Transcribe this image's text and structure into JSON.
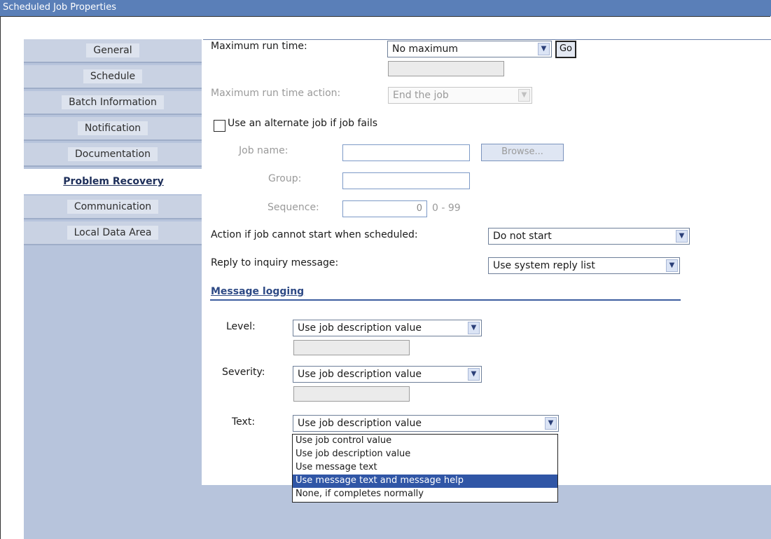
{
  "window": {
    "title": "Scheduled Job Properties"
  },
  "tabs": [
    {
      "label": "General"
    },
    {
      "label": "Schedule"
    },
    {
      "label": "Batch Information"
    },
    {
      "label": "Notification"
    },
    {
      "label": "Documentation"
    },
    {
      "label": "Problem Recovery",
      "active": true
    },
    {
      "label": "Communication"
    },
    {
      "label": "Local Data Area"
    }
  ],
  "form": {
    "max_run_time": {
      "label": "Maximum run time:",
      "value": "No maximum",
      "go_label": "Go"
    },
    "max_run_time_action": {
      "label": "Maximum run time action:",
      "value": "End the job"
    },
    "alternate_job": {
      "label": "Use an alternate job if job fails",
      "checked": false
    },
    "job_name": {
      "label": "Job name:",
      "value": "",
      "browse_label": "Browse..."
    },
    "group": {
      "label": "Group:",
      "value": ""
    },
    "sequence": {
      "label": "Sequence:",
      "value": "0",
      "range": "0 - 99"
    },
    "cannot_start_action": {
      "label": "Action if job cannot start when scheduled:",
      "value": "Do not start"
    },
    "reply_inquiry": {
      "label": "Reply to inquiry message:",
      "value": "Use system reply list"
    }
  },
  "message_logging": {
    "heading": "Message logging",
    "level": {
      "label": "Level:",
      "value": "Use job description value"
    },
    "severity": {
      "label": "Severity:",
      "value": "Use job description value"
    },
    "text": {
      "label": "Text:",
      "value": "Use job description value",
      "options": [
        "Use job control value",
        "Use job description value",
        "Use message text",
        "Use message text and message help",
        "None, if completes normally"
      ],
      "highlighted_option": "Use message text and message help"
    }
  },
  "colors": {
    "title_bar": "#5a7fb8",
    "sidebar": "#b7c4dc",
    "accent": "#2e4a85",
    "selection": "#3056a6"
  }
}
